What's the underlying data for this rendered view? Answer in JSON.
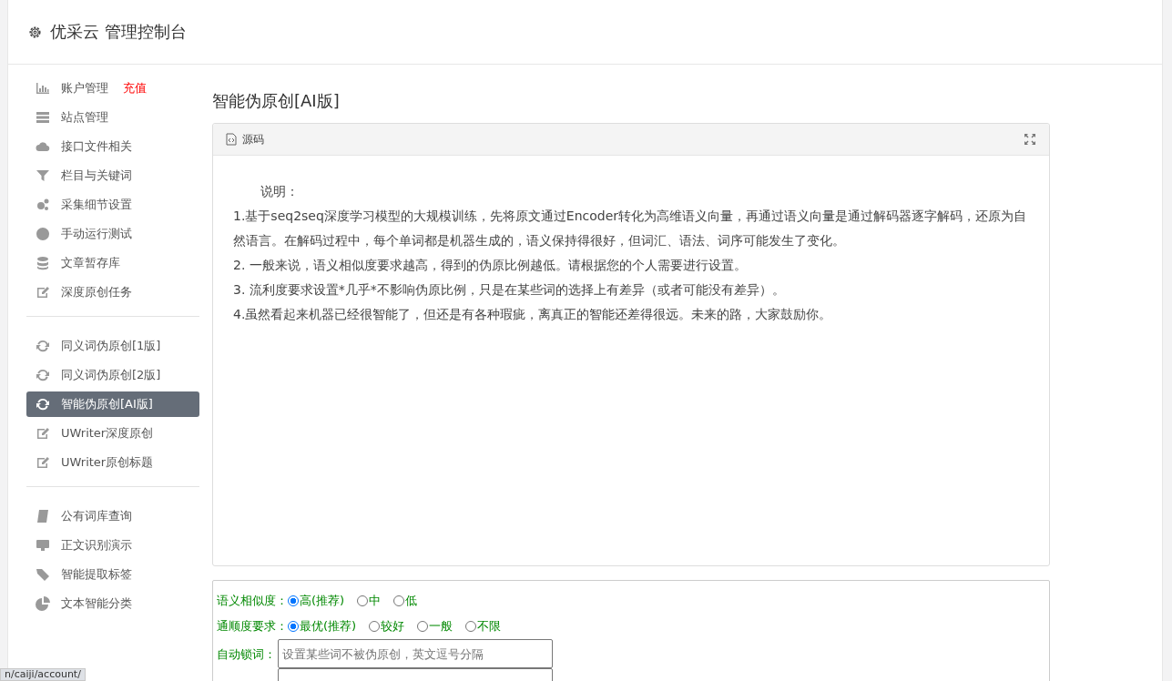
{
  "header": {
    "title": "优采云 管理控制台"
  },
  "sidebar": {
    "groups": [
      {
        "items": [
          {
            "label": "账户管理",
            "badge": "充值",
            "selected": false
          },
          {
            "label": "站点管理",
            "selected": false
          },
          {
            "label": "接口文件相关",
            "selected": false
          },
          {
            "label": "栏目与关键词",
            "selected": false
          },
          {
            "label": "采集细节设置",
            "selected": false
          },
          {
            "label": "手动运行测试",
            "selected": false
          },
          {
            "label": "文章暂存库",
            "selected": false
          },
          {
            "label": "深度原创任务",
            "selected": false
          }
        ]
      },
      {
        "items": [
          {
            "label": "同义词伪原创[1版]",
            "selected": false
          },
          {
            "label": "同义词伪原创[2版]",
            "selected": false
          },
          {
            "label": "智能伪原创[AI版]",
            "selected": true
          },
          {
            "label": "UWriter深度原创",
            "selected": false
          },
          {
            "label": "UWriter原创标题",
            "selected": false
          }
        ]
      },
      {
        "items": [
          {
            "label": "公有词库查询",
            "selected": false
          },
          {
            "label": "正文识别演示",
            "selected": false
          },
          {
            "label": "智能提取标签",
            "selected": false
          },
          {
            "label": "文本智能分类",
            "selected": false
          }
        ]
      }
    ]
  },
  "content": {
    "title": "智能伪原创[AI版]",
    "editor": {
      "toolbar_label": "源码",
      "heading": "说明：",
      "paragraphs": [
        "1.基于seq2seq深度学习模型的大规模训练，先将原文通过Encoder转化为高维语义向量，再通过语义向量是通过解码器逐字解码，还原为自然语言。在解码过程中，每个单词都是机器生成的，语义保持得很好，但词汇、语法、词序可能发生了变化。",
        "2. 一般来说，语义相似度要求越高，得到的伪原比例越低。请根据您的个人需要进行设置。",
        "3. 流利度要求设置*几乎*不影响伪原比例，只是在某些词的选择上有差异（或者可能没有差异）。",
        "4.虽然看起来机器已经很智能了，但还是有各种瑕疵，离真正的智能还差得很远。未来的路，大家鼓励你。"
      ]
    },
    "options": [
      {
        "label": "语义相似度：",
        "choices": [
          {
            "label": "高(推荐)",
            "selected": true
          },
          {
            "label": "中",
            "selected": false
          },
          {
            "label": "低",
            "selected": false
          }
        ]
      },
      {
        "label": "通顺度要求：",
        "choices": [
          {
            "label": "最优(推荐)",
            "selected": true
          },
          {
            "label": "较好",
            "selected": false
          },
          {
            "label": "一般",
            "selected": false
          },
          {
            "label": "不限",
            "selected": false
          }
        ]
      }
    ],
    "lock_words": {
      "label": "自动锁词：",
      "placeholder": "设置某些词不被伪原创，英文逗号分隔"
    }
  },
  "status_url": "n/caiji/account/"
}
